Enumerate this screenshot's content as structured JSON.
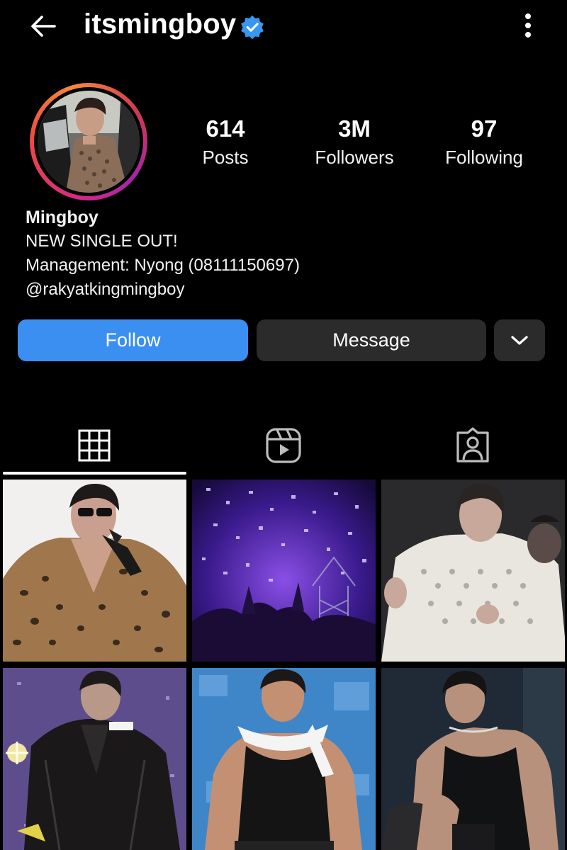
{
  "header": {
    "username": "itsmingboy",
    "back_icon": "arrow-left-icon",
    "verified_icon": "verified-badge-icon",
    "more_icon": "more-vertical-icon"
  },
  "profile": {
    "stats": [
      {
        "value": "614",
        "label": "Posts"
      },
      {
        "value": "3M",
        "label": "Followers"
      },
      {
        "value": "97",
        "label": "Following"
      }
    ],
    "display_name": "Mingboy",
    "bio_lines": [
      "NEW SINGLE OUT!",
      "Management: Nyong (08111150697)",
      "@rakyatkingmingboy"
    ]
  },
  "actions": {
    "follow_label": "Follow",
    "message_label": "Message",
    "more_icon": "chevron-down-icon"
  },
  "tabs": [
    {
      "icon": "grid-icon",
      "active": true
    },
    {
      "icon": "reels-icon",
      "active": false
    },
    {
      "icon": "tagged-icon",
      "active": false
    }
  ],
  "colors": {
    "follow_button": "#3a8ff0",
    "secondary_button": "#2b2b2b",
    "verified_badge": "#3897f0",
    "background": "#000000"
  }
}
